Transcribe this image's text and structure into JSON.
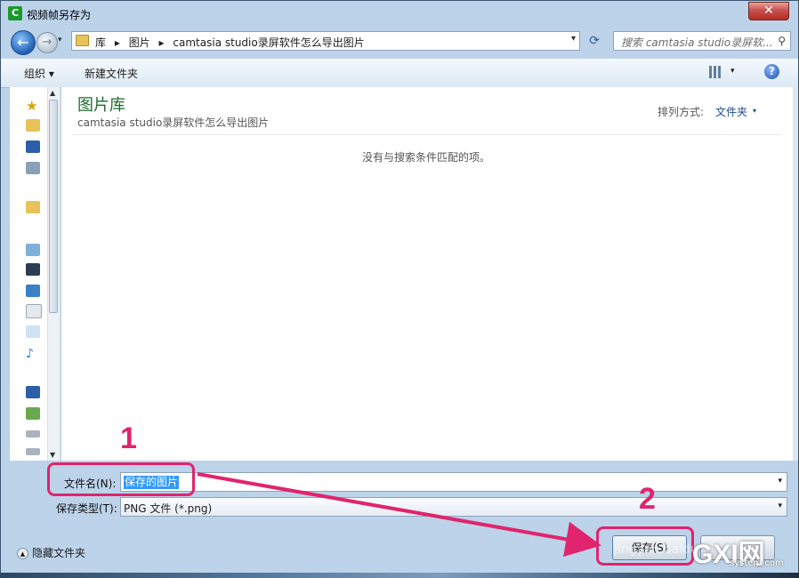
{
  "window": {
    "title": "视频帧另存为",
    "app_icon_letter": "C",
    "close_glyph": "✕"
  },
  "nav": {
    "back_glyph": "←",
    "forward_glyph": "→",
    "history_glyph": "▾",
    "breadcrumbs": [
      "库",
      "▸",
      "图片",
      "▸",
      "camtasia studio录屏软件怎么导出图片"
    ],
    "address_drop_glyph": "▾",
    "refresh_glyph": "⟳",
    "search_placeholder": "搜索 camtasia studio录屏软...",
    "search_icon": "⚲"
  },
  "toolbar": {
    "organize": "组织 ▾",
    "new_folder": "新建文件夹",
    "view_drop_glyph": "▾",
    "help_glyph": "?"
  },
  "content": {
    "library_title": "图片库",
    "library_subtitle": "camtasia studio录屏软件怎么导出图片",
    "arrange_label": "排列方式:",
    "arrange_value": "文件夹",
    "arrange_drop_glyph": "▾",
    "empty_message": "没有与搜索条件匹配的项。"
  },
  "nav_scroll": {
    "up": "▲",
    "down": "▼"
  },
  "form": {
    "filename_label": "文件名(N):",
    "filename_value": "保存的图片",
    "filename_drop": "▾",
    "filetype_label": "保存类型(T):",
    "filetype_value": "PNG 文件 (*.png)",
    "filetype_drop": "▾",
    "hide_folders": "隐藏文件夹",
    "hide_arrow": "▲",
    "save_button": "保存(S)"
  },
  "annotations": {
    "step1": "1",
    "step2": "2",
    "accent_color": "#e0246e"
  },
  "watermark": {
    "brand": "GXI网",
    "sub": "system.com",
    "baidu": "jingyan.baidu"
  },
  "icons": [
    "star-icon",
    "folder-icon",
    "desktop-icon",
    "network-icon",
    "folder-icon",
    "library-icon",
    "video-icon",
    "pictures-icon",
    "documents-icon",
    "music-icon",
    "computer-icon",
    "drive-icon",
    "drive-icon"
  ]
}
